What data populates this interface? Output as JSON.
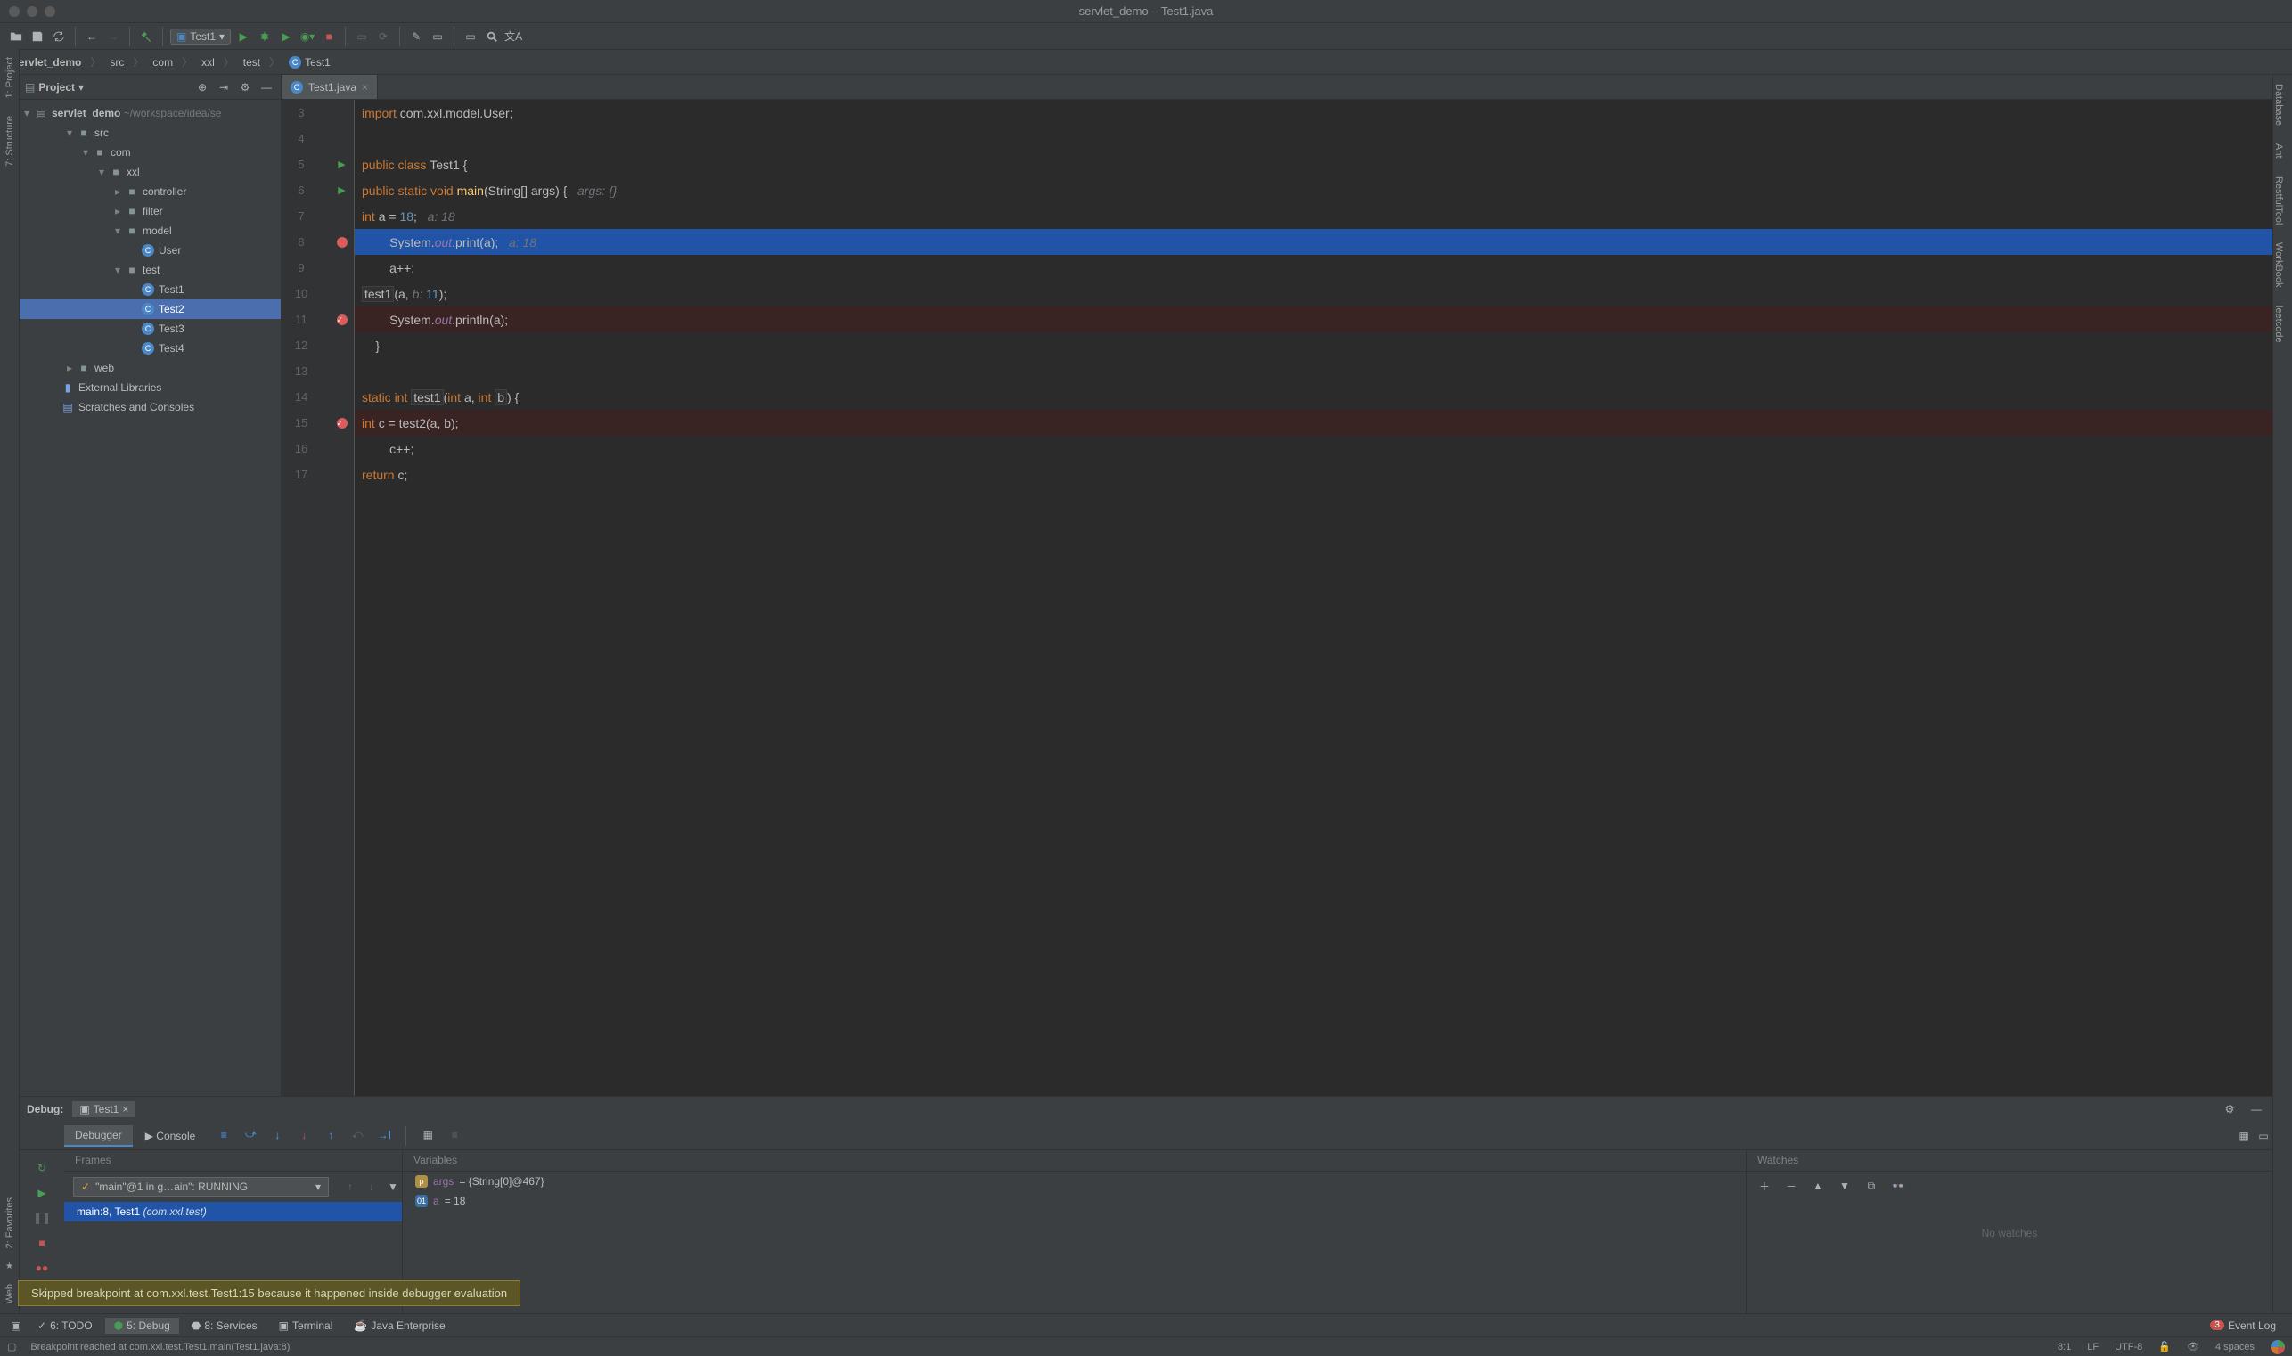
{
  "window": {
    "title": "servlet_demo – Test1.java"
  },
  "toolbar": {
    "run_config": "Test1"
  },
  "breadcrumbs": [
    "servlet_demo",
    "src",
    "com",
    "xxl",
    "test",
    "Test1"
  ],
  "project_panel": {
    "title": "Project",
    "root": {
      "name": "servlet_demo",
      "path": "~/workspace/idea/se"
    },
    "tree": [
      {
        "name": "src",
        "depth": 1,
        "type": "folder",
        "open": true
      },
      {
        "name": "com",
        "depth": 2,
        "type": "folder",
        "open": true
      },
      {
        "name": "xxl",
        "depth": 3,
        "type": "folder",
        "open": true
      },
      {
        "name": "controller",
        "depth": 4,
        "type": "folder"
      },
      {
        "name": "filter",
        "depth": 4,
        "type": "folder"
      },
      {
        "name": "model",
        "depth": 4,
        "type": "folder",
        "open": true
      },
      {
        "name": "User",
        "depth": 5,
        "type": "class"
      },
      {
        "name": "test",
        "depth": 4,
        "type": "folder",
        "open": true
      },
      {
        "name": "Test1",
        "depth": 5,
        "type": "class"
      },
      {
        "name": "Test2",
        "depth": 5,
        "type": "class",
        "selected": true
      },
      {
        "name": "Test3",
        "depth": 5,
        "type": "class"
      },
      {
        "name": "Test4",
        "depth": 5,
        "type": "class"
      },
      {
        "name": "web",
        "depth": 1,
        "type": "folder"
      },
      {
        "name": "External Libraries",
        "depth": 0,
        "type": "lib"
      },
      {
        "name": "Scratches and Consoles",
        "depth": 0,
        "type": "scratch"
      }
    ]
  },
  "editor": {
    "tab": "Test1.java",
    "first_line_no": 3,
    "lines": [
      {
        "n": 3,
        "tokens": [
          {
            "t": "import ",
            "c": "kw"
          },
          {
            "t": "com.xxl.model.User;",
            "c": ""
          }
        ]
      },
      {
        "n": 4,
        "tokens": []
      },
      {
        "n": 5,
        "run": true,
        "tokens": [
          {
            "t": "public class ",
            "c": "kw"
          },
          {
            "t": "Test1 {",
            "c": ""
          }
        ]
      },
      {
        "n": 6,
        "run": true,
        "indent": 1,
        "tokens": [
          {
            "t": "public static void ",
            "c": "kw"
          },
          {
            "t": "main",
            "c": "method"
          },
          {
            "t": "(String[] args) {   ",
            "c": ""
          },
          {
            "t": "args: {}",
            "c": "hint"
          }
        ]
      },
      {
        "n": 7,
        "indent": 2,
        "tokens": [
          {
            "t": "int ",
            "c": "kw"
          },
          {
            "t": "a = ",
            "c": ""
          },
          {
            "t": "18",
            "c": "num"
          },
          {
            "t": ";   ",
            "c": ""
          },
          {
            "t": "a: 18",
            "c": "hint"
          }
        ]
      },
      {
        "n": 8,
        "bp": "plain",
        "hl": "exec",
        "indent": 2,
        "tokens": [
          {
            "t": "System.",
            "c": ""
          },
          {
            "t": "out",
            "c": "field-ref"
          },
          {
            "t": ".print(a);   ",
            "c": ""
          },
          {
            "t": "a: 18",
            "c": "hint"
          }
        ]
      },
      {
        "n": 9,
        "indent": 2,
        "tokens": [
          {
            "t": "a++;",
            "c": ""
          }
        ]
      },
      {
        "n": 10,
        "indent": 2,
        "tokens": [
          {
            "t": "test1",
            "c": "box"
          },
          {
            "t": "(a, ",
            "c": ""
          },
          {
            "t": "b: ",
            "c": "hint"
          },
          {
            "t": "11",
            "c": "num"
          },
          {
            "t": ");",
            "c": ""
          }
        ]
      },
      {
        "n": 11,
        "bp": "chk",
        "hl": "bp",
        "indent": 2,
        "tokens": [
          {
            "t": "System.",
            "c": ""
          },
          {
            "t": "out",
            "c": "field-ref"
          },
          {
            "t": ".println(a);",
            "c": ""
          }
        ]
      },
      {
        "n": 12,
        "indent": 1,
        "tokens": [
          {
            "t": "}",
            "c": ""
          }
        ]
      },
      {
        "n": 13,
        "tokens": []
      },
      {
        "n": 14,
        "indent": 1,
        "tokens": [
          {
            "t": "static int ",
            "c": "kw"
          },
          {
            "t": "test1",
            "c": "box"
          },
          {
            "t": "(",
            "c": ""
          },
          {
            "t": "int ",
            "c": "kw"
          },
          {
            "t": "a, ",
            "c": ""
          },
          {
            "t": "int ",
            "c": "kw"
          },
          {
            "t": "b",
            "c": "box"
          },
          {
            "t": ") {",
            "c": ""
          }
        ]
      },
      {
        "n": 15,
        "bp": "chk",
        "hl": "bp",
        "indent": 2,
        "tokens": [
          {
            "t": "int ",
            "c": "kw"
          },
          {
            "t": "c = ",
            "c": ""
          },
          {
            "t": "test2",
            "c": ""
          },
          {
            "t": "(a, b);",
            "c": ""
          }
        ]
      },
      {
        "n": 16,
        "indent": 2,
        "tokens": [
          {
            "t": "c++;",
            "c": ""
          }
        ]
      },
      {
        "n": 17,
        "indent": 2,
        "tokens": [
          {
            "t": "return ",
            "c": "kw"
          },
          {
            "t": "c;",
            "c": ""
          }
        ]
      }
    ]
  },
  "debug": {
    "label": "Debug:",
    "session": "Test1",
    "tabs": {
      "debugger": "Debugger",
      "console": "Console"
    },
    "frames_title": "Frames",
    "variables_title": "Variables",
    "watches_title": "Watches",
    "thread": "\"main\"@1 in g…ain\": RUNNING",
    "frame": {
      "loc": "main:8, Test1",
      "pkg": "(com.xxl.test)"
    },
    "vars": [
      {
        "ic": "p",
        "name": "args",
        "val": "= {String[0]@467}"
      },
      {
        "ic": "01",
        "name": "a",
        "val": "= 18"
      }
    ],
    "no_watches": "No watches"
  },
  "notification": "Skipped breakpoint at com.xxl.test.Test1:15 because it happened inside debugger evaluation",
  "bottom_tools": {
    "todo": "6: TODO",
    "debug": "5: Debug",
    "services": "8: Services",
    "terminal": "Terminal",
    "jee": "Java Enterprise",
    "eventlog": "Event Log",
    "events_count": "3"
  },
  "status": {
    "msg": "Breakpoint reached at com.xxl.test.Test1.main(Test1.java:8)",
    "pos": "8:1",
    "sep": "LF",
    "enc": "UTF-8",
    "indent": "4 spaces"
  },
  "left_rail": [
    "1: Project",
    "7: Structure"
  ],
  "right_rail": [
    "Database",
    "Ant",
    "RestfulTool",
    "WorkBook",
    "leetcode"
  ],
  "left_rail_bottom": [
    "2: Favorites",
    "Web"
  ]
}
